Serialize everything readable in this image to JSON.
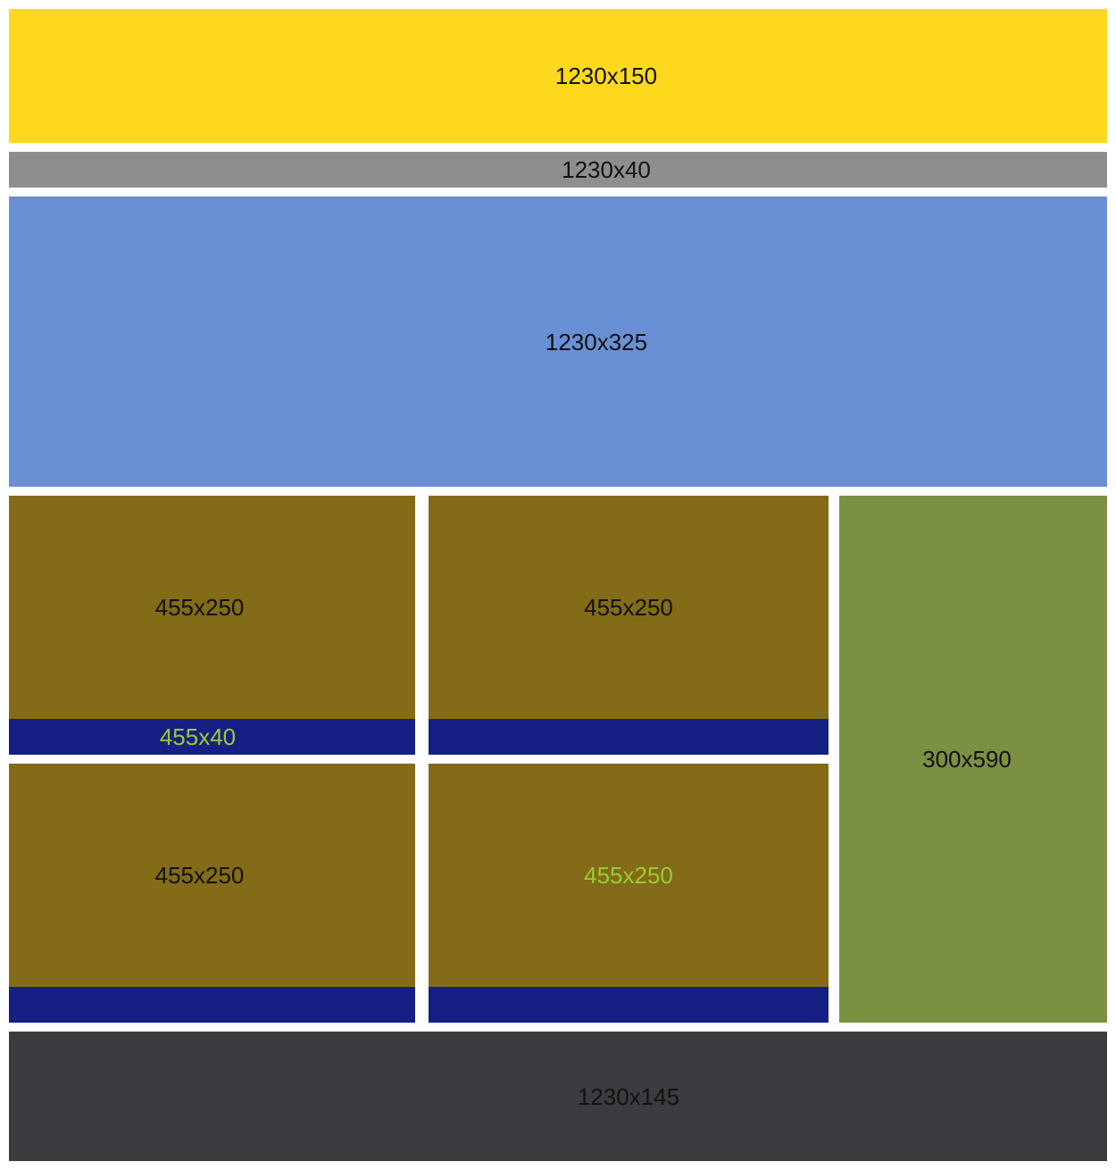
{
  "colors": {
    "header": "#fed81d",
    "navbar": "#8e8e8e",
    "hero": "#6990d4",
    "card": "#836b17",
    "bar": "#162084",
    "sidebar": "#7c9041",
    "footer": "#3c3b40",
    "label_default": "#111111",
    "label_accent": "#99cc33"
  },
  "blocks": {
    "header": {
      "label": "1230x150"
    },
    "navbar": {
      "label": "1230x40"
    },
    "hero": {
      "label": "1230x325"
    },
    "card_1": {
      "label": "455x250"
    },
    "bar_1": {
      "label": "455x40"
    },
    "card_2": {
      "label": "455x250"
    },
    "bar_2": {
      "label": ""
    },
    "card_3": {
      "label": "455x250"
    },
    "bar_3": {
      "label": ""
    },
    "card_4": {
      "label": "455x250"
    },
    "bar_4": {
      "label": ""
    },
    "sidebar": {
      "label": "300x590"
    },
    "footer": {
      "label": "1230x145"
    }
  }
}
